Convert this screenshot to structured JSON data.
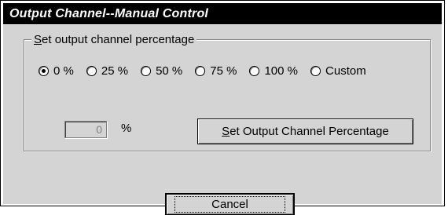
{
  "window": {
    "title": "Output Channel--Manual Control"
  },
  "group": {
    "legend_first": "S",
    "legend_rest": "et output channel percentage"
  },
  "radios": [
    {
      "label": "0 %",
      "checked": true
    },
    {
      "label": "25 %",
      "checked": false
    },
    {
      "label": "50 %",
      "checked": false
    },
    {
      "label": "75 %",
      "checked": false
    },
    {
      "label": "100 %",
      "checked": false
    },
    {
      "label": "Custom",
      "checked": false
    }
  ],
  "custom": {
    "value": "0",
    "unit": "%"
  },
  "buttons": {
    "set_first": "S",
    "set_rest": "et Output Channel Percentage",
    "cancel": "Cancel"
  }
}
